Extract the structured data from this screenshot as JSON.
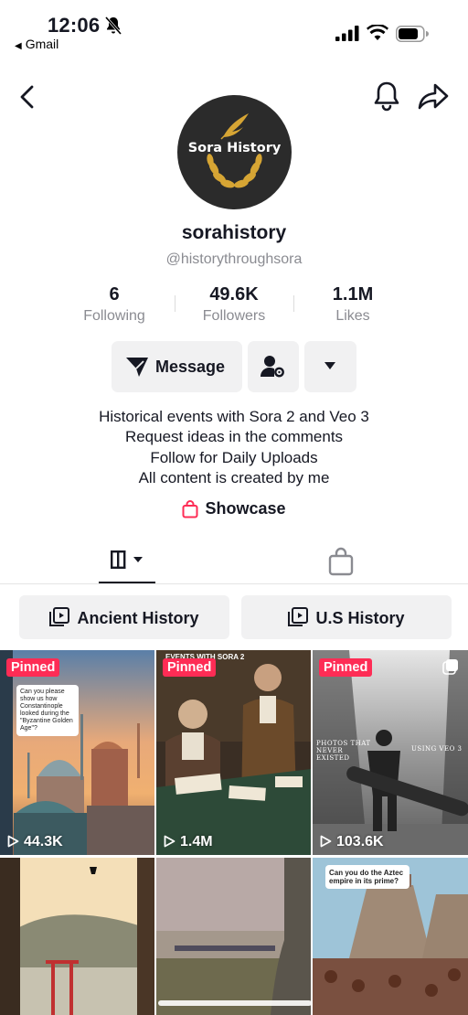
{
  "status_bar": {
    "time": "12:06",
    "back_app": "Gmail",
    "icons": [
      "bell-slash-icon",
      "signal-icon",
      "wifi-icon",
      "battery-icon"
    ]
  },
  "nav": {
    "icons": [
      "back-arrow-icon",
      "bell-icon",
      "share-icon"
    ]
  },
  "profile": {
    "avatar_text": "Sora History",
    "username": "sorahistory",
    "handle": "@historythroughsora",
    "stats": [
      {
        "value": "6",
        "label": "Following"
      },
      {
        "value": "49.6K",
        "label": "Followers"
      },
      {
        "value": "1.1M",
        "label": "Likes"
      }
    ],
    "message_label": "Message",
    "bio_lines": [
      "Historical events with Sora 2 and Veo 3",
      "Request ideas in the comments",
      "Follow for Daily Uploads",
      "All content is created by me"
    ],
    "showcase_label": "Showcase"
  },
  "playlists": [
    {
      "label": "Ancient History"
    },
    {
      "label": "U.S History"
    }
  ],
  "videos": [
    {
      "pinned": "Pinned",
      "views": "44.3K",
      "question": "Can you please show us how Constantinople looked during the \"Byzantine Golden Age\"?"
    },
    {
      "pinned": "Pinned",
      "views": "1.4M",
      "overlay": "EVENTS WITH SORA 2"
    },
    {
      "pinned": "Pinned",
      "views": "103.6K",
      "cap_left": "PHOTOS THAT NEVER EXISTED",
      "cap_right": "USING VEO 3"
    },
    {
      "pinned": "",
      "views": ""
    },
    {
      "pinned": "",
      "views": ""
    },
    {
      "pinned": "",
      "views": "",
      "question": "Can you do the Aztec empire in its prime?"
    }
  ],
  "colors": {
    "accent": "#fe2c55",
    "button_bg": "#f1f1f2",
    "muted_text": "#8a8b91",
    "text": "#161823"
  }
}
